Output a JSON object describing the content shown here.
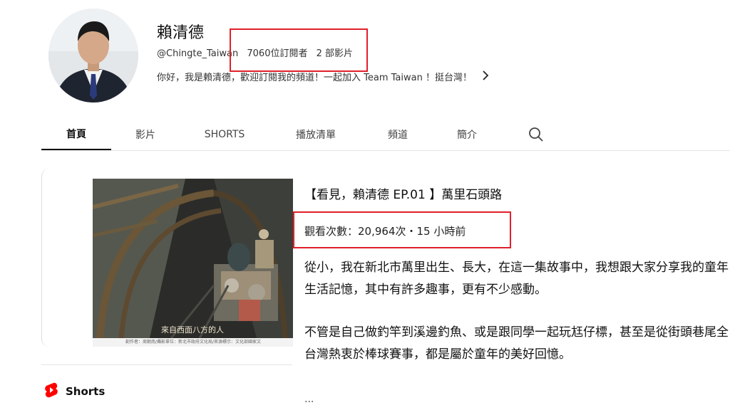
{
  "channel": {
    "name": "賴清德",
    "handle": "@Chingte_Taiwan",
    "subscribers": "7060位訂閱者",
    "videos": "2 部影片",
    "description": "你好，我是賴清德，歡迎訂閱我的頻道！一起加入 Team Taiwan ！挺台灣！"
  },
  "tabs": [
    {
      "label": "首頁",
      "active": true
    },
    {
      "label": "影片"
    },
    {
      "label": "SHORTS"
    },
    {
      "label": "播放清單"
    },
    {
      "label": "頻道"
    },
    {
      "label": "簡介"
    }
  ],
  "featured": {
    "title": "【看見，賴清德 EP.01 】萬里石頭路",
    "views": "觀看次數：20,964次・15 小時前",
    "thumbnail_overlay": "來自西面八方的人",
    "thumbnail_credit": "創作者：周朝南/攝影單位：新北市政府文化局/來源標示：文化部國家文",
    "description_p1": "從小，我在新北市萬里出生、長大，在這一集故事中，我想跟大家分享我的童年生活記憶，其中有許多趣事，更有不少感動。",
    "description_p2": "不管是自己做釣竿到溪邊釣魚、或是跟同學一起玩尪仔標，甚至是從街頭巷尾全台灣熱衷於棒球賽事，都是屬於童年的美好回憶。",
    "more": "..."
  },
  "shorts": {
    "label": "Shorts"
  },
  "colors": {
    "highlight": "#e0202a",
    "shorts_red": "#ff0000"
  },
  "icons": [
    "search-icon",
    "chevron-right-icon",
    "shorts-icon"
  ]
}
